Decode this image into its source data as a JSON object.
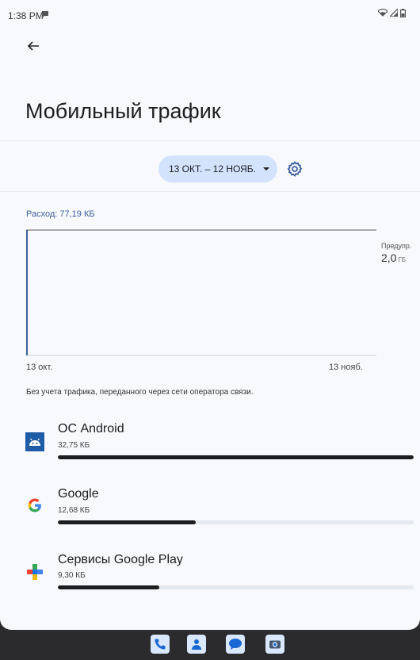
{
  "status": {
    "time": "1:38 PM"
  },
  "header": {
    "title": "Мобильный трафик"
  },
  "cycle": {
    "label": "13 ОКТ. – 12 НОЯБ."
  },
  "usage": {
    "label": "Расход: 77,19 КБ"
  },
  "chart_data": {
    "type": "line",
    "x": [
      "13 окт.",
      "13 нояб."
    ],
    "series": [],
    "warning": {
      "label": "Предупр.",
      "value": "2,0",
      "unit": "ГБ"
    },
    "grid": false
  },
  "note": "Без учета трафика, переданного через сети оператора связи.",
  "apps": [
    {
      "name": "ОС Android",
      "size": "32,75 КБ",
      "fraction": 1.0,
      "icon": "android-icon"
    },
    {
      "name": "Google",
      "size": "12,68 КБ",
      "fraction": 0.387,
      "icon": "google-icon"
    },
    {
      "name": "Сервисы Google Play",
      "size": "9,30 КБ",
      "fraction": 0.284,
      "icon": "play-services-icon"
    }
  ],
  "dock": [
    "phone-icon",
    "contacts-icon",
    "messages-icon",
    "camera-icon"
  ],
  "colors": {
    "accent": "#3d5f9e",
    "chip": "#d3e3fd",
    "bar": "#1d1d1f",
    "track": "#e4e9f0",
    "taskbar": "#2b2b2d"
  }
}
